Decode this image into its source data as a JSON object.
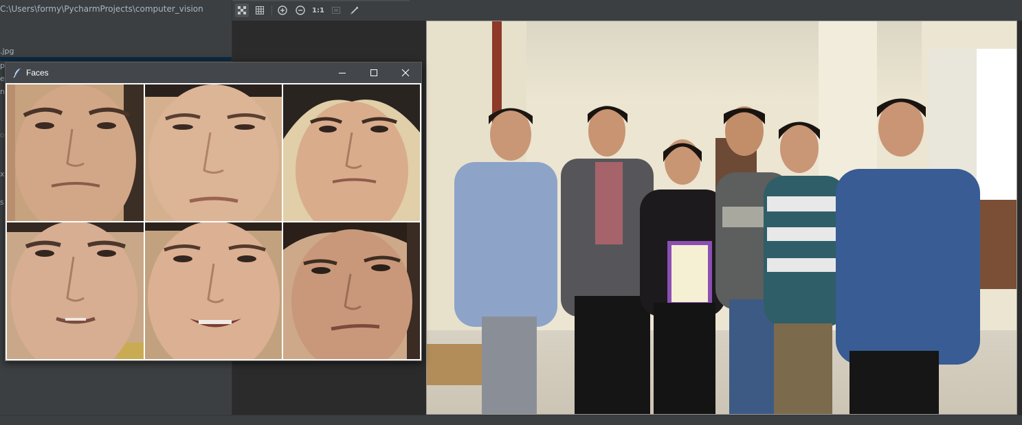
{
  "ide": {
    "project_path": "C:\\Users\\formy\\PycharmProjects\\computer_vision",
    "tree_fragments": [
      ".jpg",
      "p",
      "e",
      "n",
      "o",
      "xt",
      "s"
    ]
  },
  "viewer_toolbar": {
    "buttons": [
      {
        "name": "chessboard-toggle-button",
        "icon": "chessboard-icon",
        "active": true
      },
      {
        "name": "grid-toggle-button",
        "icon": "grid-icon",
        "active": false
      },
      {
        "name": "zoom-in-button",
        "icon": "zoom-in-icon",
        "active": false
      },
      {
        "name": "zoom-out-button",
        "icon": "zoom-out-icon",
        "active": false
      },
      {
        "name": "actual-size-button",
        "label": "1:1",
        "active": false
      },
      {
        "name": "fit-zoom-button",
        "icon": "fit-icon",
        "active": false
      },
      {
        "name": "color-picker-button",
        "icon": "eyedropper-icon",
        "active": false
      }
    ]
  },
  "faces_window": {
    "title": "Faces",
    "icon": "feather-icon",
    "controls": [
      "minimize-icon",
      "maximize-icon",
      "close-icon"
    ],
    "tiles": [
      {
        "name": "face-1"
      },
      {
        "name": "face-2"
      },
      {
        "name": "face-3"
      },
      {
        "name": "face-4"
      },
      {
        "name": "face-5"
      },
      {
        "name": "face-6"
      }
    ]
  },
  "main_image": {
    "name": "group-photo",
    "people_count": 6
  },
  "colors": {
    "ide_background": "#2b2b2b",
    "ide_panel": "#3c3f41",
    "title_bar": "#43474c",
    "selected_row": "#0d293e"
  }
}
